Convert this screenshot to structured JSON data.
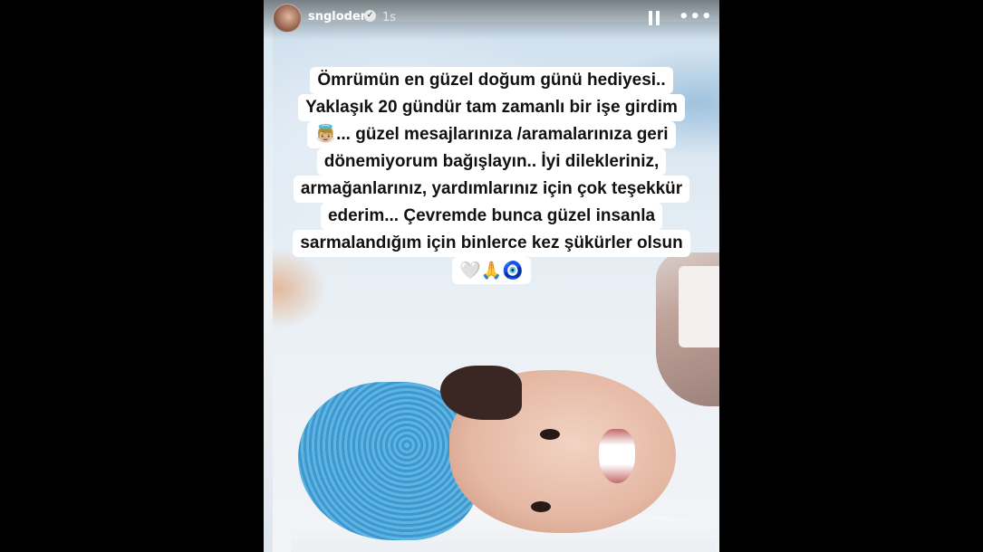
{
  "story": {
    "username": "sngloden",
    "verified_mark": "✓",
    "timestamp": "1s",
    "caption_lines": [
      "Ömrümün en güzel doğum günü hediyesi..",
      "Yaklaşık 20 gündür tam zamanlı bir işe girdim",
      "👼🏼... güzel mesajlarınıza /aramalarınıza geri",
      "dönemiyorum bağışlayın.. İyi dilekleriniz,",
      "armağanlarınız, yardımlarınız için çok teşekkür",
      "ederim... Çevremde bunca güzel insanla",
      "sarmalandığım için binlerce kez şükürler olsun",
      "🤍🙏🧿"
    ]
  },
  "icons": {
    "pause": "pause-icon",
    "more": "more-icon",
    "more_glyph": "•••"
  }
}
